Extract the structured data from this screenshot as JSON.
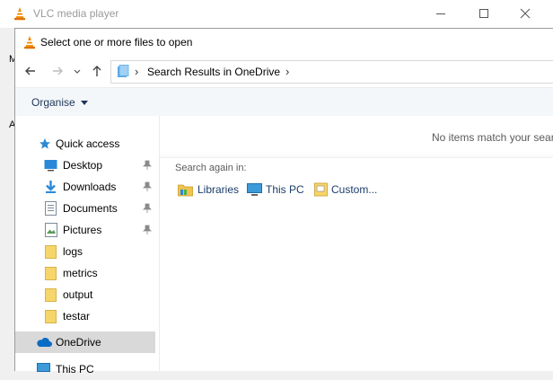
{
  "vlc": {
    "title": "VLC media player",
    "stub_letters": [
      "M",
      "A"
    ]
  },
  "dialog": {
    "title": "Select one or more files to open",
    "address": {
      "separator": "›",
      "location": "Search Results in OneDrive",
      "trailing_chevron": "›"
    },
    "toolbar": {
      "organise_label": "Organise"
    },
    "nav": {
      "quick_access": "Quick access",
      "items": [
        {
          "label": "Desktop",
          "icon": "desktop-icon",
          "pinned": true
        },
        {
          "label": "Downloads",
          "icon": "downloads-icon",
          "pinned": true
        },
        {
          "label": "Documents",
          "icon": "documents-icon",
          "pinned": true
        },
        {
          "label": "Pictures",
          "icon": "pictures-icon",
          "pinned": true
        },
        {
          "label": "logs",
          "icon": "folder-icon",
          "pinned": false
        },
        {
          "label": "metrics",
          "icon": "folder-icon",
          "pinned": false
        },
        {
          "label": "output",
          "icon": "folder-icon",
          "pinned": false
        },
        {
          "label": "testar",
          "icon": "folder-icon",
          "pinned": false
        }
      ],
      "onedrive": "OneDrive",
      "this_pc": "This PC"
    },
    "content": {
      "empty_message": "No items match your sear",
      "search_again_label": "Search again in:",
      "search_locations": [
        {
          "label": "Libraries",
          "icon": "libraries-icon"
        },
        {
          "label": "This PC",
          "icon": "this-pc-icon"
        },
        {
          "label": "Custom...",
          "icon": "custom-folder-icon"
        }
      ]
    }
  },
  "colors": {
    "selected_nav": "#d9d9d9",
    "toolbar_bg": "#f4f7fa",
    "vlc_orange": "#f08a00",
    "folder_yellow": "#f6d66a",
    "link_text": "#1b3d6b"
  }
}
